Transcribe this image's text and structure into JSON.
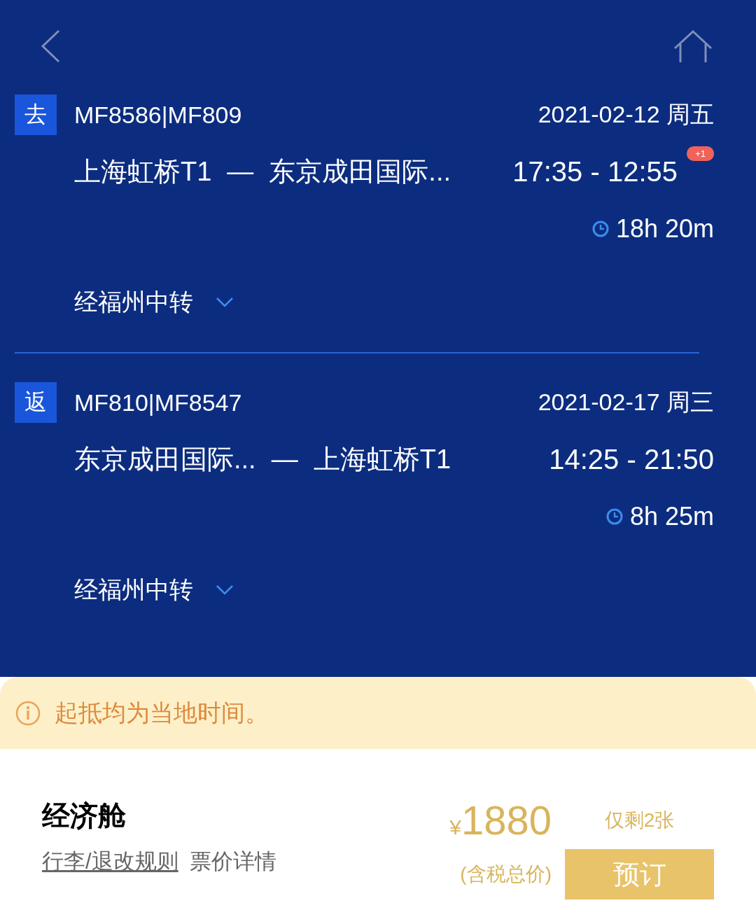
{
  "segments": [
    {
      "tag": "去",
      "flight": "MF8586|MF809",
      "date": "2021-02-12 周五",
      "from": "上海虹桥T1",
      "dash": "—",
      "to": "东京成田国际...",
      "times": "17:35 - 12:55",
      "day_offset": "+1",
      "duration": "18h 20m",
      "transfer": "经福州中转",
      "expanded": false
    },
    {
      "tag": "返",
      "flight": "MF810|MF8547",
      "date": "2021-02-17 周三",
      "from": "东京成田国际...",
      "dash": "—",
      "to": "上海虹桥T1",
      "times": "14:25 - 21:50",
      "duration": "8h 25m",
      "transfer": "经福州中转",
      "expanded": false
    }
  ],
  "notice": "起抵均为当地时间。",
  "fare": {
    "cabin": "经济舱",
    "links": [
      "行李/退改规则",
      "票价详情"
    ],
    "currency": "¥",
    "amount": "1880",
    "tax_note": "(含税总价)",
    "remaining": "仅剩2张",
    "book": "预订"
  }
}
